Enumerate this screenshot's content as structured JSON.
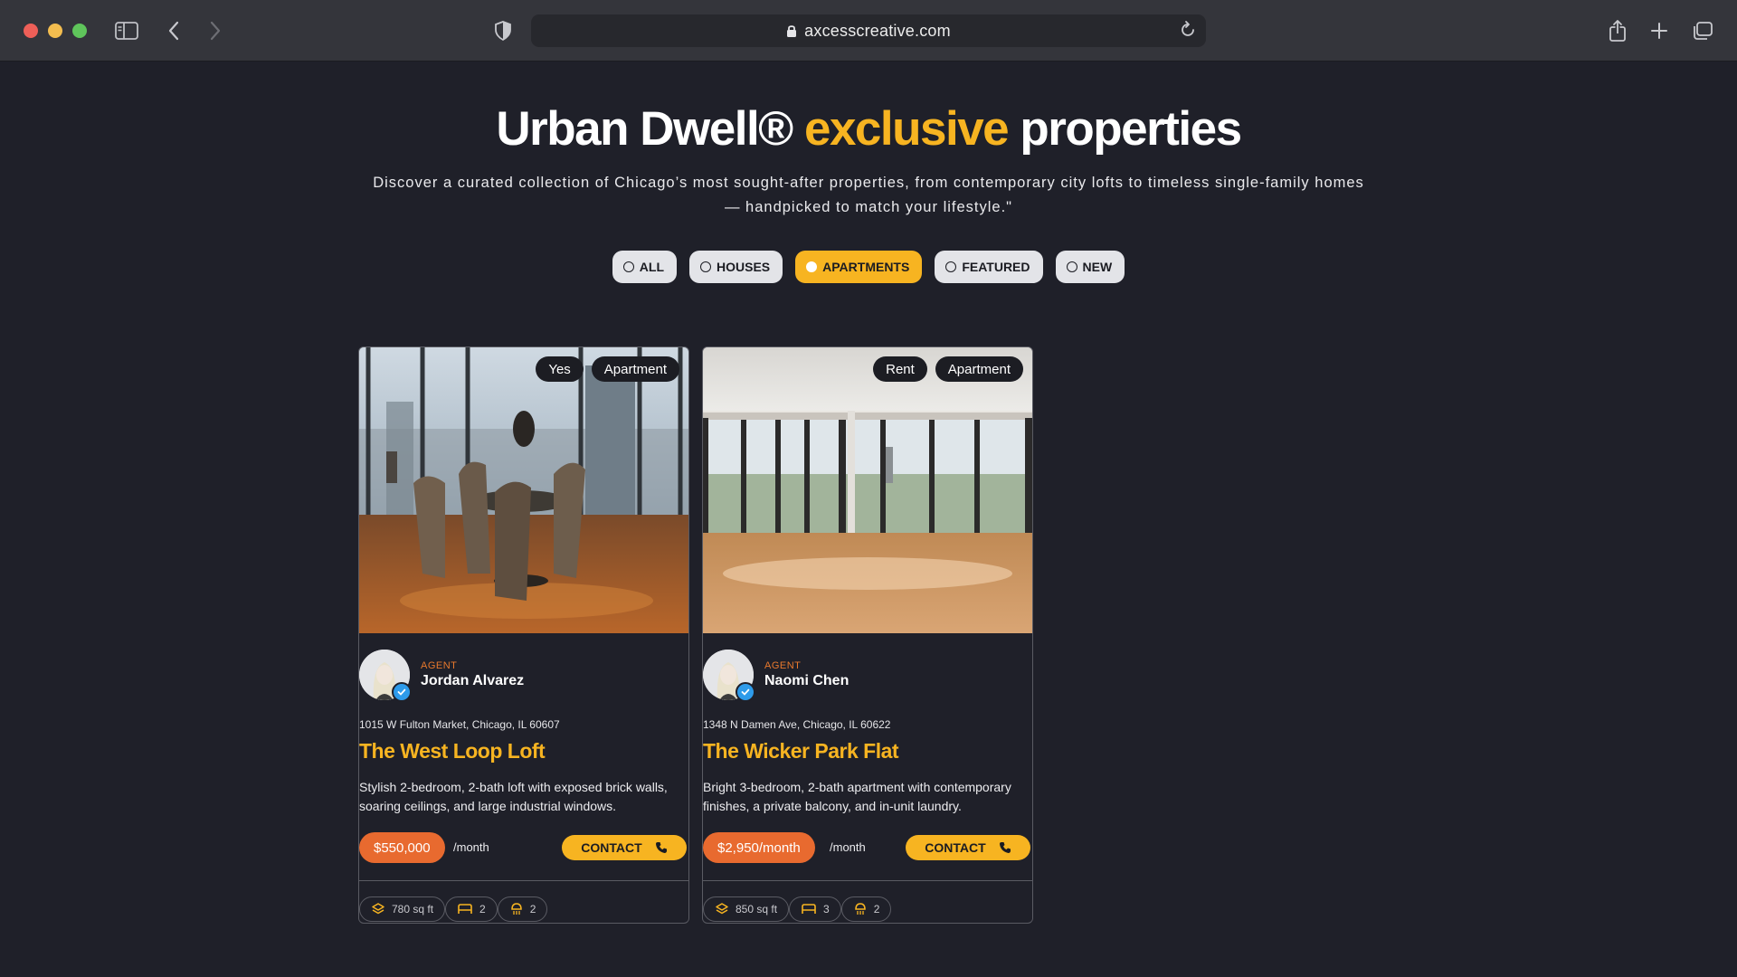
{
  "browser": {
    "url": "axcesscreative.com"
  },
  "page": {
    "headline_prefix": "Urban Dwell®",
    "headline_accent": "exclusive",
    "headline_suffix": "properties",
    "subtitle": "Discover a curated collection of Chicago’s most sought-after properties, from contemporary city lofts to timeless single-family homes — handpicked to match your lifestyle.\"",
    "accent_color": "#f7b421",
    "price_color": "#e86a2f"
  },
  "filters": [
    {
      "label": "ALL",
      "active": false
    },
    {
      "label": "HOUSES",
      "active": false
    },
    {
      "label": "APARTMENTS",
      "active": true
    },
    {
      "label": "FEATURED",
      "active": false
    },
    {
      "label": "NEW",
      "active": false
    }
  ],
  "listings": [
    {
      "tags": [
        "Yes",
        "Apartment"
      ],
      "agent_role": "AGENT",
      "agent_name": "Jordan Alvarez",
      "address": "1015 W Fulton Market, Chicago, IL 60607",
      "title": "The West Loop Loft",
      "description": "Stylish 2-bedroom, 2-bath loft with exposed brick walls, soaring ceilings, and large industrial windows.",
      "price": "$550,000",
      "per": "/month",
      "contact_label": "CONTACT",
      "area": "780 sq ft",
      "beds": "2",
      "baths": "2"
    },
    {
      "tags": [
        "Rent",
        "Apartment"
      ],
      "agent_role": "AGENT",
      "agent_name": "Naomi Chen",
      "address": "1348 N Damen Ave, Chicago, IL 60622",
      "title": "The Wicker Park Flat",
      "description": "Bright 3-bedroom, 2-bath apartment with contemporary finishes, a private balcony, and in-unit laundry.",
      "price": "$2,950/month",
      "per": "/month",
      "contact_label": "CONTACT",
      "area": "850 sq ft",
      "beds": "3",
      "baths": "2"
    }
  ]
}
